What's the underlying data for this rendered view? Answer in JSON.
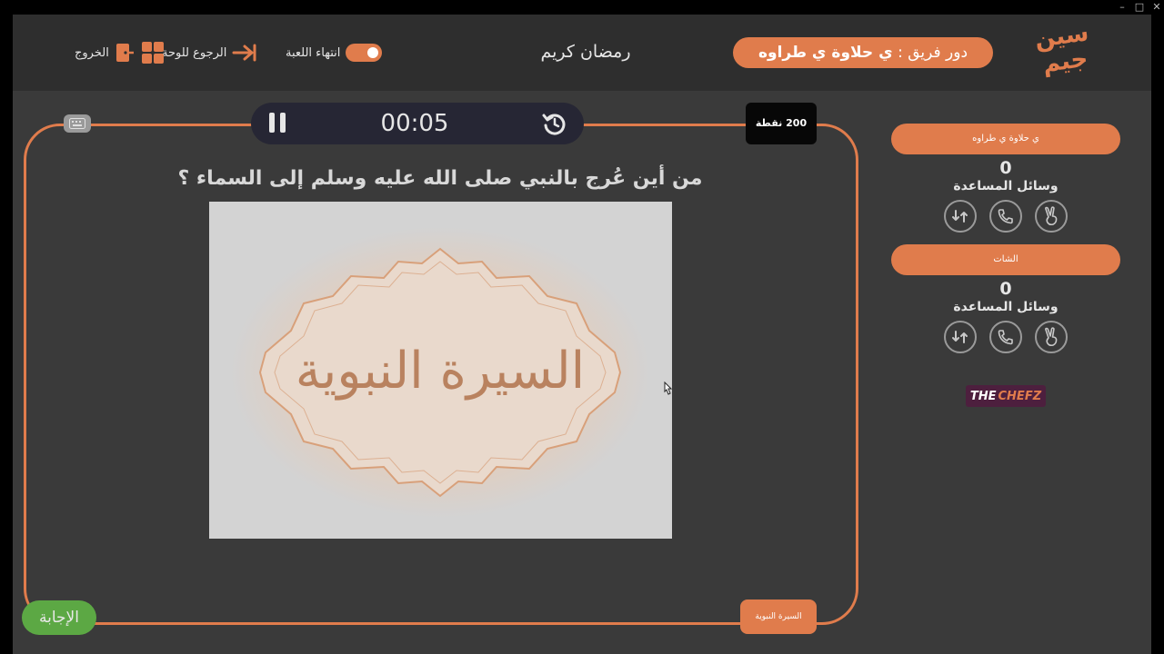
{
  "window": {
    "controls": [
      "–",
      "□",
      "✕"
    ]
  },
  "header": {
    "logo_text": "سين جيم",
    "team_turn_prefix": "دور فريق :",
    "team_turn_name": "ي حلاوة ي طراوه",
    "title": "رمضان كريم",
    "end_game_label": "انتهاء اللعبة",
    "back_to_board_label": "الرجوع للوحة",
    "exit_label": "الخروج"
  },
  "game": {
    "timer": "00:05",
    "points": "200 نقطة",
    "question": "من أين عُرج بالنبي صلى الله عليه وسلم إلى السماء ؟",
    "image_caption": "السيرة النبوية",
    "category": "السيرة النبوية",
    "answer_label": "الإجابة"
  },
  "teams": [
    {
      "name": "ي حلاوة ي طراوه",
      "score": "0",
      "aids_label": "وسائل المساعدة"
    },
    {
      "name": "الشات",
      "score": "0",
      "aids_label": "وسائل المساعدة"
    }
  ],
  "sponsor": {
    "part1": "THE",
    "part2": "CHEFZ"
  },
  "colors": {
    "accent": "#e07c4c",
    "background": "#3a3a3a",
    "header": "#2e2e2e",
    "answer": "#5ca844"
  }
}
